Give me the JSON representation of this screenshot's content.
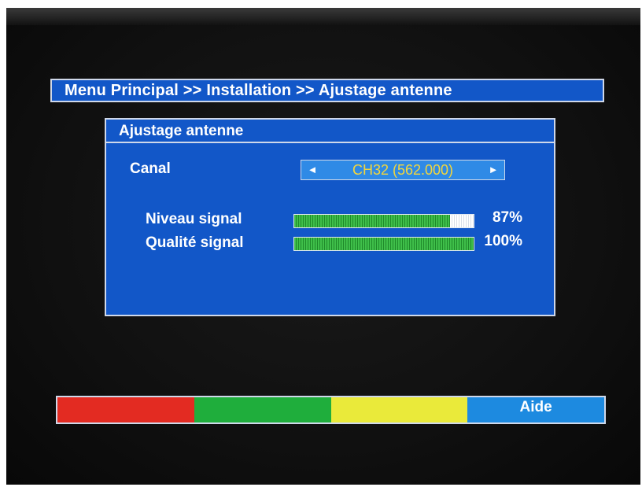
{
  "breadcrumb": {
    "text": "Menu Principal >> Installation >> Ajustage antenne"
  },
  "panel": {
    "title": "Ajustage antenne",
    "canal": {
      "label": "Canal",
      "value": "CH32 (562.000)",
      "left_arrow_icon": "triangle-left-icon",
      "right_arrow_icon": "triangle-right-icon"
    },
    "signal_level": {
      "label": "Niveau signal",
      "percent_text": "87%",
      "fraction": 0.87
    },
    "signal_quality": {
      "label": "Qualité signal",
      "percent_text": "100%",
      "fraction": 1.0
    }
  },
  "color_keys": {
    "red": {
      "color": "#e32b22",
      "label": ""
    },
    "green": {
      "color": "#1fae3c",
      "label": ""
    },
    "yellow": {
      "color": "#eaea3a",
      "label": ""
    },
    "blue": {
      "color": "#1d8ae0",
      "label": "Aide"
    }
  },
  "colors": {
    "menu_blue": "#1257c8",
    "border": "#cfd8ea",
    "selector_blue": "#2f8ae6",
    "channel_text": "#f4d63a"
  }
}
